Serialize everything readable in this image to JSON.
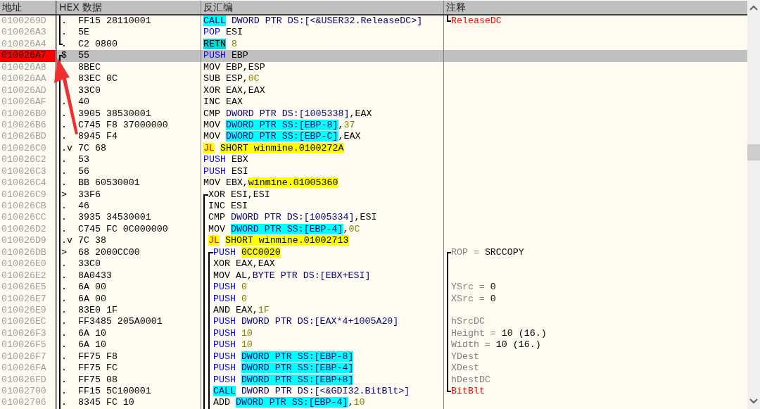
{
  "columns": [
    {
      "label": "地址"
    },
    {
      "label": "HEX 数据"
    },
    {
      "label": "反汇编"
    },
    {
      "label": "注释"
    }
  ],
  "rows": [
    {
      "address": "0100269D",
      "breakpoint": false,
      "selected": false,
      "bracket": {
        "opens": false,
        "closes": false
      },
      "marker": ".",
      "hex": "FF15 28110001",
      "code": [
        {
          "text": "CALL",
          "kind": "call"
        },
        {
          "text": "DWORD PTR DS:[<&USER32.ReleaseDC>]",
          "kind": "mem"
        }
      ],
      "comment_bracket": {
        "opens": false,
        "closes": true
      },
      "comment": [
        {
          "text": "ReleaseDC",
          "kind": "api"
        }
      ]
    },
    {
      "address": "010026A3",
      "breakpoint": false,
      "selected": false,
      "bracket": {
        "opens": false,
        "closes": false
      },
      "marker": ".",
      "hex": "5E",
      "code": [
        {
          "text": "POP",
          "kind": "push"
        },
        {
          "text": "ESI",
          "kind": "plain"
        }
      ]
    },
    {
      "address": "010026A4",
      "breakpoint": false,
      "selected": false,
      "bracket": {
        "opens": false,
        "closes": true
      },
      "marker": ".",
      "hex": "C2 0800",
      "code": [
        {
          "text": "RETN",
          "kind": "ret"
        },
        {
          "text": "8",
          "kind": "imm"
        }
      ]
    },
    {
      "address": "010026A7",
      "breakpoint": true,
      "selected": true,
      "bracket": {
        "opens": true,
        "closes": false
      },
      "marker": "$",
      "hex": "55",
      "code": [
        {
          "text": "PUSH",
          "kind": "push"
        },
        {
          "text": "EBP",
          "kind": "plain"
        }
      ]
    },
    {
      "address": "010026A8",
      "breakpoint": false,
      "selected": false,
      "bracket": {
        "opens": false,
        "closes": false
      },
      "hex": "8BEC",
      "code": [
        {
          "text": "MOV EBP,ESP",
          "kind": "plain"
        }
      ]
    },
    {
      "address": "010026AA",
      "breakpoint": false,
      "selected": false,
      "bracket": {
        "opens": false,
        "closes": false
      },
      "hex": "83EC 0C",
      "code": [
        {
          "text": "SUB ESP,",
          "kind": "plain"
        },
        {
          "text": "0C",
          "kind": "imm"
        }
      ]
    },
    {
      "address": "010026AD",
      "breakpoint": false,
      "selected": false,
      "bracket": {
        "opens": false,
        "closes": false
      },
      "hex": "33C0",
      "code": [
        {
          "text": "XOR EAX,EAX",
          "kind": "plain"
        }
      ]
    },
    {
      "address": "010026AF",
      "breakpoint": false,
      "selected": false,
      "bracket": {
        "opens": false,
        "closes": false
      },
      "marker": ".",
      "hex": "40",
      "code": [
        {
          "text": "INC EAX",
          "kind": "plain"
        }
      ]
    },
    {
      "address": "010026B0",
      "breakpoint": false,
      "selected": false,
      "bracket": {
        "opens": false,
        "closes": false
      },
      "marker": ".",
      "hex": "3905 38530001",
      "code": [
        {
          "text": "CMP ",
          "kind": "plain"
        },
        {
          "text": "DWORD PTR DS:[1005338]",
          "kind": "mem"
        },
        {
          "text": ",EAX",
          "kind": "plain"
        }
      ]
    },
    {
      "address": "010026B6",
      "breakpoint": false,
      "selected": false,
      "bracket": {
        "opens": false,
        "closes": false
      },
      "marker": ".",
      "hex": "C745 F8 37000000",
      "code": [
        {
          "text": "MOV ",
          "kind": "plain"
        },
        {
          "text": "DWORD PTR SS:[EBP-8]",
          "kind": "hl"
        },
        {
          "text": ",",
          "kind": "plain"
        },
        {
          "text": "37",
          "kind": "imm"
        }
      ]
    },
    {
      "address": "010026BD",
      "breakpoint": false,
      "selected": false,
      "bracket": {
        "opens": false,
        "closes": false
      },
      "marker": ".",
      "hex": "8945 F4",
      "code": [
        {
          "text": "MOV ",
          "kind": "plain"
        },
        {
          "text": "DWORD PTR SS:[EBP-C]",
          "kind": "hl"
        },
        {
          "text": ",EAX",
          "kind": "plain"
        }
      ]
    },
    {
      "address": "010026C0",
      "breakpoint": false,
      "selected": false,
      "bracket": {
        "opens": false,
        "closes": false
      },
      "marker": ".v",
      "hex": "7C 68",
      "code": [
        {
          "text": "JL",
          "kind": "jmp"
        },
        {
          "text": "SHORT winmine.0100272A",
          "kind": "target"
        }
      ]
    },
    {
      "address": "010026C2",
      "breakpoint": false,
      "selected": false,
      "bracket": {
        "opens": false,
        "closes": false
      },
      "marker": ".",
      "hex": "53",
      "code": [
        {
          "text": "PUSH",
          "kind": "push"
        },
        {
          "text": "EBX",
          "kind": "plain"
        }
      ]
    },
    {
      "address": "010026C3",
      "breakpoint": false,
      "selected": false,
      "bracket": {
        "opens": false,
        "closes": false
      },
      "marker": ".",
      "hex": "56",
      "code": [
        {
          "text": "PUSH",
          "kind": "push"
        },
        {
          "text": "ESI",
          "kind": "plain"
        }
      ]
    },
    {
      "address": "010026C4",
      "breakpoint": false,
      "selected": false,
      "bracket": {
        "opens": false,
        "closes": false
      },
      "marker": ".",
      "hex": "BB 60530001",
      "code": [
        {
          "text": "MOV EBX,",
          "kind": "plain"
        },
        {
          "text": "winmine.01005360",
          "kind": "target"
        }
      ]
    },
    {
      "address": "010026C9",
      "breakpoint": false,
      "selected": false,
      "bracket": {
        "opens": false,
        "closes": false
      },
      "marker": ">",
      "hex": "33F6",
      "loops": [
        {
          "opens": true
        }
      ],
      "code": [
        {
          "text": "XOR ESI,ESI",
          "kind": "plain"
        }
      ]
    },
    {
      "address": "010026CB",
      "breakpoint": false,
      "selected": false,
      "bracket": {
        "opens": false,
        "closes": false
      },
      "marker": ".",
      "hex": "46",
      "loops": [
        {
          "opens": false
        }
      ],
      "code": [
        {
          "text": "INC ESI",
          "kind": "plain"
        }
      ]
    },
    {
      "address": "010026CC",
      "breakpoint": false,
      "selected": false,
      "bracket": {
        "opens": false,
        "closes": false
      },
      "marker": ".",
      "hex": "3935 34530001",
      "loops": [
        {
          "opens": false
        }
      ],
      "code": [
        {
          "text": "CMP ",
          "kind": "plain"
        },
        {
          "text": "DWORD PTR DS:[1005334]",
          "kind": "mem"
        },
        {
          "text": ",ESI",
          "kind": "plain"
        }
      ]
    },
    {
      "address": "010026D2",
      "breakpoint": false,
      "selected": false,
      "bracket": {
        "opens": false,
        "closes": false
      },
      "marker": ".",
      "hex": "C745 FC 0C000000",
      "loops": [
        {
          "opens": false
        }
      ],
      "code": [
        {
          "text": "MOV ",
          "kind": "plain"
        },
        {
          "text": "DWORD PTR SS:[EBP-4]",
          "kind": "hl"
        },
        {
          "text": ",",
          "kind": "plain"
        },
        {
          "text": "0C",
          "kind": "imm"
        }
      ]
    },
    {
      "address": "010026D9",
      "breakpoint": false,
      "selected": false,
      "bracket": {
        "opens": false,
        "closes": false
      },
      "marker": ".v",
      "hex": "7C 38",
      "loops": [
        {
          "opens": false
        }
      ],
      "code": [
        {
          "text": "JL",
          "kind": "jmp"
        },
        {
          "text": "SHORT winmine.01002713",
          "kind": "target"
        }
      ]
    },
    {
      "address": "010026DB",
      "breakpoint": false,
      "selected": false,
      "bracket": {
        "opens": false,
        "closes": false
      },
      "marker": ">",
      "hex": "68 2000CC00",
      "loops": [
        {
          "opens": false
        },
        {
          "opens": true
        }
      ],
      "code": [
        {
          "text": "PUSH",
          "kind": "push"
        },
        {
          "text": "0CC0020",
          "kind": "target"
        }
      ],
      "comment_bracket": {
        "opens": true,
        "closes": false
      },
      "comment": [
        {
          "text": "ROP = ",
          "kind": "label"
        },
        {
          "text": "SRCCOPY",
          "kind": "value"
        }
      ]
    },
    {
      "address": "010026E0",
      "breakpoint": false,
      "selected": false,
      "bracket": {
        "opens": false,
        "closes": false
      },
      "marker": ".",
      "hex": "33C0",
      "loops": [
        {
          "opens": false
        },
        {
          "opens": false
        }
      ],
      "code": [
        {
          "text": "XOR EAX,EAX",
          "kind": "plain"
        }
      ],
      "comment_bracket": {
        "opens": false,
        "closes": false
      }
    },
    {
      "address": "010026E2",
      "breakpoint": false,
      "selected": false,
      "bracket": {
        "opens": false,
        "closes": false
      },
      "marker": ".",
      "hex": "8A0433",
      "loops": [
        {
          "opens": false
        },
        {
          "opens": false
        }
      ],
      "code": [
        {
          "text": "MOV AL,",
          "kind": "plain"
        },
        {
          "text": "BYTE PTR DS:[EBX+ESI]",
          "kind": "mem"
        }
      ],
      "comment_bracket": {
        "opens": false,
        "closes": false
      }
    },
    {
      "address": "010026E5",
      "breakpoint": false,
      "selected": false,
      "bracket": {
        "opens": false,
        "closes": false
      },
      "marker": ".",
      "hex": "6A 00",
      "loops": [
        {
          "opens": false
        },
        {
          "opens": false
        }
      ],
      "code": [
        {
          "text": "PUSH",
          "kind": "push"
        },
        {
          "text": "0",
          "kind": "imm"
        }
      ],
      "comment_bracket": {
        "opens": false,
        "closes": false
      },
      "comment": [
        {
          "text": "YSrc = ",
          "kind": "label"
        },
        {
          "text": "0",
          "kind": "value"
        }
      ]
    },
    {
      "address": "010026E7",
      "breakpoint": false,
      "selected": false,
      "bracket": {
        "opens": false,
        "closes": false
      },
      "marker": ".",
      "hex": "6A 00",
      "loops": [
        {
          "opens": false
        },
        {
          "opens": false
        }
      ],
      "code": [
        {
          "text": "PUSH",
          "kind": "push"
        },
        {
          "text": "0",
          "kind": "imm"
        }
      ],
      "comment_bracket": {
        "opens": false,
        "closes": false
      },
      "comment": [
        {
          "text": "XSrc = ",
          "kind": "label"
        },
        {
          "text": "0",
          "kind": "value"
        }
      ]
    },
    {
      "address": "010026E9",
      "breakpoint": false,
      "selected": false,
      "bracket": {
        "opens": false,
        "closes": false
      },
      "marker": ".",
      "hex": "83E0 1F",
      "loops": [
        {
          "opens": false
        },
        {
          "opens": false
        }
      ],
      "code": [
        {
          "text": "AND EAX,",
          "kind": "plain"
        },
        {
          "text": "1F",
          "kind": "imm"
        }
      ],
      "comment_bracket": {
        "opens": false,
        "closes": false
      }
    },
    {
      "address": "010026EC",
      "breakpoint": false,
      "selected": false,
      "bracket": {
        "opens": false,
        "closes": false
      },
      "marker": ".",
      "hex": "FF3485 205A0001",
      "loops": [
        {
          "opens": false
        },
        {
          "opens": false
        }
      ],
      "code": [
        {
          "text": "PUSH",
          "kind": "push"
        },
        {
          "text": "DWORD PTR DS:[EAX*4+1005A20]",
          "kind": "mem"
        }
      ],
      "comment_bracket": {
        "opens": false,
        "closes": false
      },
      "comment": [
        {
          "text": "hSrcDC",
          "kind": "label"
        }
      ]
    },
    {
      "address": "010026F3",
      "breakpoint": false,
      "selected": false,
      "bracket": {
        "opens": false,
        "closes": false
      },
      "marker": ".",
      "hex": "6A 10",
      "loops": [
        {
          "opens": false
        },
        {
          "opens": false
        }
      ],
      "code": [
        {
          "text": "PUSH",
          "kind": "push"
        },
        {
          "text": "10",
          "kind": "imm"
        }
      ],
      "comment_bracket": {
        "opens": false,
        "closes": false
      },
      "comment": [
        {
          "text": "Height = ",
          "kind": "label"
        },
        {
          "text": "10 (16.)",
          "kind": "value"
        }
      ]
    },
    {
      "address": "010026F5",
      "breakpoint": false,
      "selected": false,
      "bracket": {
        "opens": false,
        "closes": false
      },
      "marker": ".",
      "hex": "6A 10",
      "loops": [
        {
          "opens": false
        },
        {
          "opens": false
        }
      ],
      "code": [
        {
          "text": "PUSH",
          "kind": "push"
        },
        {
          "text": "10",
          "kind": "imm"
        }
      ],
      "comment_bracket": {
        "opens": false,
        "closes": false
      },
      "comment": [
        {
          "text": "Width = ",
          "kind": "label"
        },
        {
          "text": "10 (16.)",
          "kind": "value"
        }
      ]
    },
    {
      "address": "010026F7",
      "breakpoint": false,
      "selected": false,
      "bracket": {
        "opens": false,
        "closes": false
      },
      "marker": ".",
      "hex": "FF75 F8",
      "loops": [
        {
          "opens": false
        },
        {
          "opens": false
        }
      ],
      "code": [
        {
          "text": "PUSH",
          "kind": "push"
        },
        {
          "text": "DWORD PTR SS:[EBP-8]",
          "kind": "hl"
        }
      ],
      "comment_bracket": {
        "opens": false,
        "closes": false
      },
      "comment": [
        {
          "text": "YDest",
          "kind": "label"
        }
      ]
    },
    {
      "address": "010026FA",
      "breakpoint": false,
      "selected": false,
      "bracket": {
        "opens": false,
        "closes": false
      },
      "marker": ".",
      "hex": "FF75 FC",
      "loops": [
        {
          "opens": false
        },
        {
          "opens": false
        }
      ],
      "code": [
        {
          "text": "PUSH",
          "kind": "push"
        },
        {
          "text": "DWORD PTR SS:[EBP-4]",
          "kind": "hl"
        }
      ],
      "comment_bracket": {
        "opens": false,
        "closes": false
      },
      "comment": [
        {
          "text": "XDest",
          "kind": "label"
        }
      ]
    },
    {
      "address": "010026FD",
      "breakpoint": false,
      "selected": false,
      "bracket": {
        "opens": false,
        "closes": false
      },
      "marker": ".",
      "hex": "FF75 08",
      "loops": [
        {
          "opens": false
        },
        {
          "opens": false
        }
      ],
      "code": [
        {
          "text": "PUSH",
          "kind": "push"
        },
        {
          "text": "DWORD PTR SS:[EBP+8]",
          "kind": "hl"
        }
      ],
      "comment_bracket": {
        "opens": false,
        "closes": false
      },
      "comment": [
        {
          "text": "hDestDC",
          "kind": "label"
        }
      ]
    },
    {
      "address": "01002700",
      "breakpoint": false,
      "selected": false,
      "bracket": {
        "opens": false,
        "closes": false
      },
      "marker": ".",
      "hex": "FF15 5C100001",
      "loops": [
        {
          "opens": false
        },
        {
          "opens": false
        }
      ],
      "code": [
        {
          "text": "CALL",
          "kind": "call"
        },
        {
          "text": "DWORD PTR DS:[<&GDI32.BitBlt>]",
          "kind": "mem"
        }
      ],
      "comment_bracket": {
        "opens": false,
        "closes": true
      },
      "comment": [
        {
          "text": "BitBlt",
          "kind": "api"
        }
      ]
    },
    {
      "address": "01002706",
      "breakpoint": false,
      "selected": false,
      "bracket": {
        "opens": false,
        "closes": false
      },
      "marker": ".",
      "hex": "8345 FC 10",
      "loops": [
        {
          "opens": false
        },
        {
          "opens": false
        }
      ],
      "code": [
        {
          "text": "ADD ",
          "kind": "plain"
        },
        {
          "text": "DWORD PTR SS:[EBP-4]",
          "kind": "hl"
        },
        {
          "text": ",",
          "kind": "plain"
        },
        {
          "text": "10",
          "kind": "imm"
        }
      ]
    }
  ]
}
